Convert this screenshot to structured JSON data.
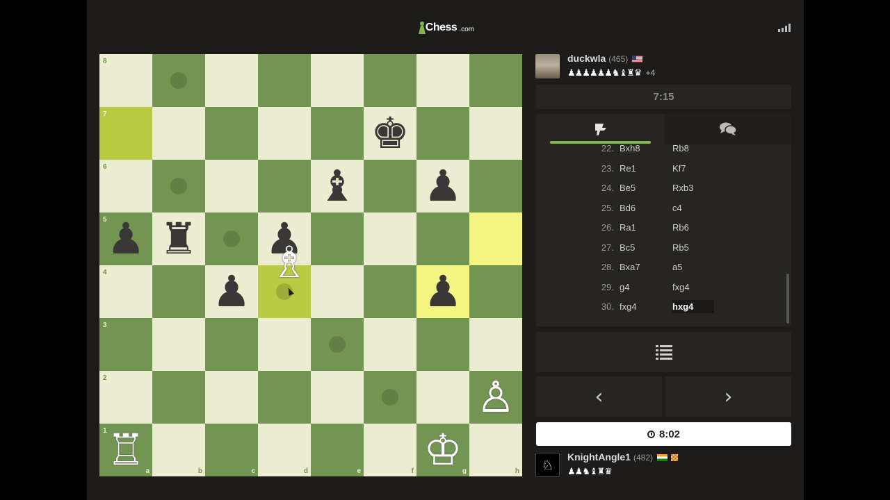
{
  "app": {
    "logo_word": "Chess",
    "logo_domain": ".com"
  },
  "top_player": {
    "name": "duckwla",
    "rating": "(465)",
    "flag": "US",
    "captured": "♟♟♟♟♟♟♞♝♜♛",
    "advantage": "+4"
  },
  "top_clock": "7:15",
  "bottom_player": {
    "name": "KnightAngle1",
    "rating": "(482)",
    "flag": "IN",
    "captured": "♟♟♞♝♜♛"
  },
  "bottom_clock": "8:02",
  "board": {
    "files": [
      "a",
      "b",
      "c",
      "d",
      "e",
      "f",
      "g",
      "h"
    ],
    "ranks": [
      "8",
      "7",
      "6",
      "5",
      "4",
      "3",
      "2",
      "1"
    ],
    "highlights": [
      "a7",
      "h5",
      "d4",
      "g4"
    ],
    "hints": [
      "b8",
      "b6",
      "c5",
      "d4",
      "e3",
      "f2"
    ],
    "pieces": [
      {
        "square": "f7",
        "glyph": "♚",
        "color": "black",
        "name": "black-king"
      },
      {
        "square": "e6",
        "glyph": "♝",
        "color": "black",
        "name": "black-bishop"
      },
      {
        "square": "g6",
        "glyph": "♟",
        "color": "black",
        "name": "black-pawn"
      },
      {
        "square": "a5",
        "glyph": "♟",
        "color": "black",
        "name": "black-pawn"
      },
      {
        "square": "b5",
        "glyph": "♜",
        "color": "black",
        "name": "black-rook"
      },
      {
        "square": "d5",
        "glyph": "♟",
        "color": "black",
        "name": "black-pawn"
      },
      {
        "square": "c4",
        "glyph": "♟",
        "color": "black",
        "name": "black-pawn"
      },
      {
        "square": "g4",
        "glyph": "♟",
        "color": "black",
        "name": "black-pawn"
      },
      {
        "square": "h2",
        "glyph": "♙",
        "color": "white",
        "name": "white-pawn"
      },
      {
        "square": "a1",
        "glyph": "♖",
        "color": "white",
        "name": "white-rook"
      },
      {
        "square": "g1",
        "glyph": "♔",
        "color": "white",
        "name": "white-king"
      }
    ],
    "dragged_piece": {
      "glyph": "♗",
      "color": "white",
      "name": "white-bishop",
      "near_square": "d4"
    }
  },
  "moves": [
    {
      "num": "22.",
      "white": "Bxh8",
      "black": "Rb8"
    },
    {
      "num": "23.",
      "white": "Re1",
      "black": "Kf7"
    },
    {
      "num": "24.",
      "white": "Be5",
      "black": "Rxb3"
    },
    {
      "num": "25.",
      "white": "Bd6",
      "black": "c4"
    },
    {
      "num": "26.",
      "white": "Ra1",
      "black": "Rb6"
    },
    {
      "num": "27.",
      "white": "Bc5",
      "black": "Rb5"
    },
    {
      "num": "28.",
      "white": "Bxa7",
      "black": "a5"
    },
    {
      "num": "29.",
      "white": "g4",
      "black": "fxg4"
    },
    {
      "num": "30.",
      "white": "fxg4",
      "black": "hxg4"
    }
  ],
  "current_move": "30b",
  "icons": {
    "moves_tab": "pawn-icon",
    "chat_tab": "chat-icon",
    "list": "list-icon",
    "prev": "chevron-left-icon",
    "next": "chevron-right-icon",
    "clock": "clock-icon"
  },
  "nav": {
    "prev_glyph": "‹",
    "next_glyph": "›"
  },
  "colors": {
    "light_square": "#ebecd0",
    "dark_square": "#739552",
    "highlight_light": "#f5f682",
    "highlight_dark": "#b9ca43",
    "accent": "#81b64c"
  }
}
